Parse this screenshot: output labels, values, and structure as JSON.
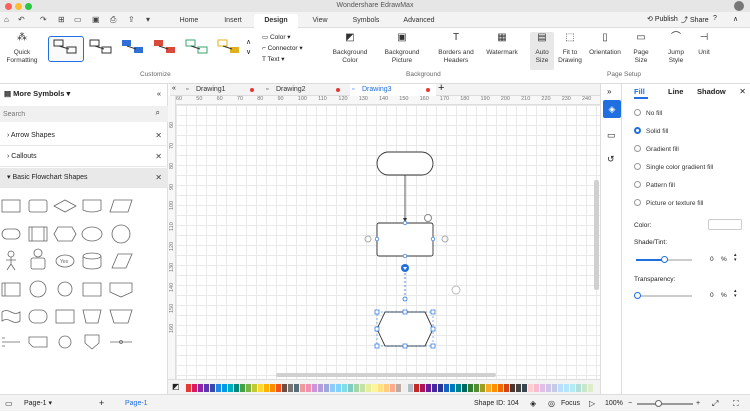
{
  "app": {
    "title": "Wondershare EdrawMax"
  },
  "menu": {
    "tabs": [
      "Home",
      "Insert",
      "Design",
      "View",
      "Symbols",
      "Advanced"
    ],
    "active": "Design",
    "publish_label": "Publish",
    "share_label": "Share"
  },
  "ribbon": {
    "quick_formatting": "Quick Formatting",
    "color": "Color",
    "connector": "Connector",
    "text": "Text",
    "background_color": "Background Color",
    "background_picture": "Background Picture",
    "borders_headers": "Borders and Headers",
    "watermark": "Watermark",
    "auto_size": "Auto Size",
    "fit_to_drawing": "Fit to Drawing",
    "orientation": "Orientation",
    "page_size": "Page Size",
    "jump_style": "Jump Style",
    "unit": "Unit",
    "group_customize": "Customize",
    "group_background": "Background",
    "group_page_setup": "Page Setup"
  },
  "library": {
    "title": "More Symbols",
    "search_placeholder": "Search",
    "sections": [
      "Arrow Shapes",
      "Callouts",
      "Basic Flowchart Shapes"
    ]
  },
  "documents": {
    "tabs": [
      "Drawing1",
      "Drawing2",
      "Drawing3"
    ],
    "active": "Drawing3"
  },
  "ruler": {
    "h_ticks": [
      "60",
      "50",
      "60",
      "70",
      "80",
      "90",
      "100",
      "110",
      "120",
      "130",
      "140",
      "150",
      "160",
      "170",
      "180",
      "190",
      "200",
      "210",
      "220",
      "230",
      "240"
    ],
    "v_ticks": [
      "60",
      "70",
      "80",
      "90",
      "100",
      "110",
      "120",
      "130",
      "140",
      "150",
      "160"
    ]
  },
  "format_panel": {
    "tabs": [
      "Fill",
      "Line",
      "Shadow"
    ],
    "fill_options": [
      "No fill",
      "Solid fill",
      "Gradient fill",
      "Single color gradient fill",
      "Pattern fill",
      "Picture or texture fill"
    ],
    "selected_fill": "Solid fill",
    "color_label": "Color:",
    "shade_label": "Shade/Tint:",
    "shade_value": "0",
    "shade_unit": "%",
    "transparency_label": "Transparency:",
    "transparency_value": "0",
    "transparency_unit": "%"
  },
  "status": {
    "page_tab": "Page-1",
    "page_label": "Page-1",
    "shape_id": "Shape ID: 104",
    "focus": "Focus",
    "zoom": "100%"
  },
  "palette_colors": [
    "#e53935",
    "#d81b60",
    "#8e24aa",
    "#5e35b1",
    "#3949ab",
    "#1e88e5",
    "#039be5",
    "#00acc1",
    "#00897b",
    "#43a047",
    "#7cb342",
    "#c0ca33",
    "#fdd835",
    "#ffb300",
    "#fb8c00",
    "#f4511e",
    "#6d4c41",
    "#757575",
    "#546e7a",
    "#ef9a9a",
    "#f48fb1",
    "#ce93d8",
    "#b39ddb",
    "#9fa8da",
    "#90caf9",
    "#81d4fa",
    "#80deea",
    "#80cbc4",
    "#a5d6a7",
    "#c5e1a5",
    "#e6ee9c",
    "#fff59d",
    "#ffe082",
    "#ffcc80",
    "#ffab91",
    "#bcaaa4",
    "#eeeeee",
    "#b0bec5",
    "#c62828",
    "#ad1457",
    "#6a1b9a",
    "#4527a0",
    "#283593",
    "#1565c0",
    "#0277bd",
    "#00838f",
    "#00695c",
    "#2e7d32",
    "#558b2f",
    "#9e9d24",
    "#f9a825",
    "#ff8f00",
    "#ef6c00",
    "#d84315",
    "#4e342e",
    "#424242",
    "#37474f",
    "#ffcdd2",
    "#f8bbd0",
    "#e1bee7",
    "#d1c4e9",
    "#c5cae9",
    "#bbdefb",
    "#b3e5fc",
    "#b2ebf2",
    "#b2dfdb",
    "#c8e6c9",
    "#dcedc8"
  ]
}
